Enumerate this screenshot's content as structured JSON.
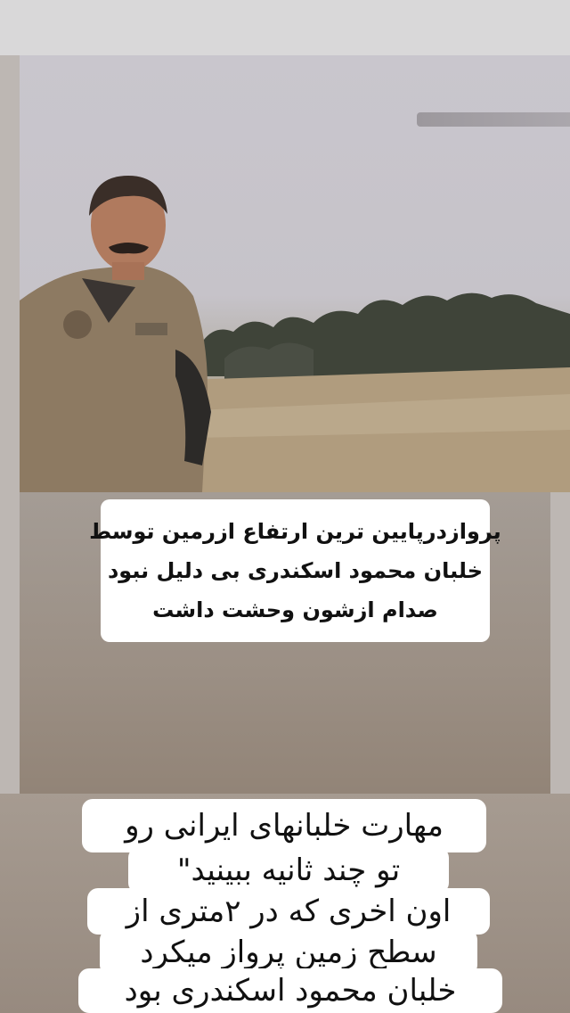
{
  "caption_box": {
    "lines": [
      "پروازدرپایین ترین ارتفاع ازرمین توسط",
      "خلبان محمود اسکندری بی دلیل نبود",
      "صدام ازشون وحشت داشت"
    ]
  },
  "bottom_text": {
    "lines": [
      "مهارت خلبانهای ایرانی رو",
      "تو چند ثانیه ببینید\"",
      "اون اخری که در ۲متری از",
      "سطح زمین پرواز میکرد",
      "خلبان محمود اسکندری بود"
    ]
  },
  "colors": {
    "sticker_bg": "#ffffff",
    "text": "#111111",
    "flight_suit": "#8d7a62"
  }
}
